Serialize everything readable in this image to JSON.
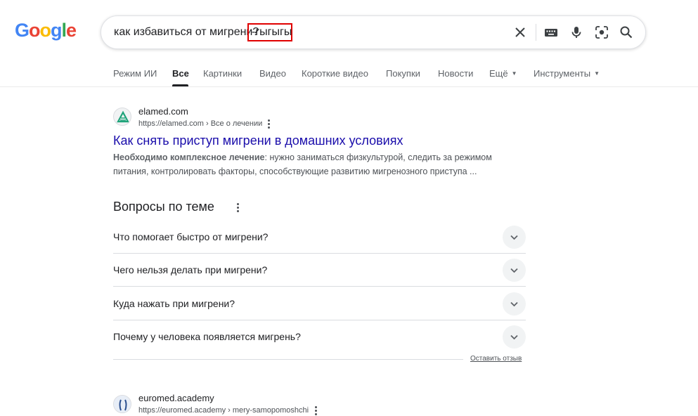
{
  "logo": {
    "letters": [
      "G",
      "o",
      "o",
      "g",
      "l",
      "e"
    ],
    "colors": [
      "#4285f4",
      "#ea4335",
      "#fbbc05",
      "#4285f4",
      "#34a853",
      "#ea4335"
    ]
  },
  "search": {
    "query_main": "как избавиться от мигрени?",
    "query_highlight": "-гыгыгы",
    "highlight_color": "#e00000",
    "icons": [
      "close-icon",
      "keyboard-icon",
      "microphone-icon",
      "lens-icon",
      "search-icon"
    ]
  },
  "tabs": [
    {
      "label": "Режим ИИ"
    },
    {
      "label": "Все",
      "active": true
    },
    {
      "label": "Картинки"
    },
    {
      "label": "Видео"
    },
    {
      "label": "Короткие видео"
    },
    {
      "label": "Покупки"
    },
    {
      "label": "Новости"
    },
    {
      "label": "Ещё"
    },
    {
      "label": "Инструменты"
    }
  ],
  "result1": {
    "site": "elamed.com",
    "url": "https://elamed.com › Все о лечении",
    "title": "Как снять приступ мигрени в домашних условиях",
    "snippet_bold": "Необходимо комплексное лечение",
    "snippet_rest": ": нужно заниматься физкультурой, следить за режимом питания, контролировать факторы, способствующие развитию мигренозного приступа ...",
    "accent": "#1fa37a"
  },
  "paa": {
    "title": "Вопросы по теме",
    "questions": [
      "Что помогает быстро от мигрени?",
      "Чего нельзя делать при мигрени?",
      "Куда нажать при мигрени?",
      "Почему у человека появляется мигрень?"
    ],
    "feedback": "Оставить отзыв"
  },
  "result2": {
    "site": "euromed.academy",
    "url": "https://euromed.academy › mery-samopomoshchi"
  },
  "colors": {
    "link": "#1a0dab",
    "text": "#202124",
    "muted": "#4d5156"
  }
}
